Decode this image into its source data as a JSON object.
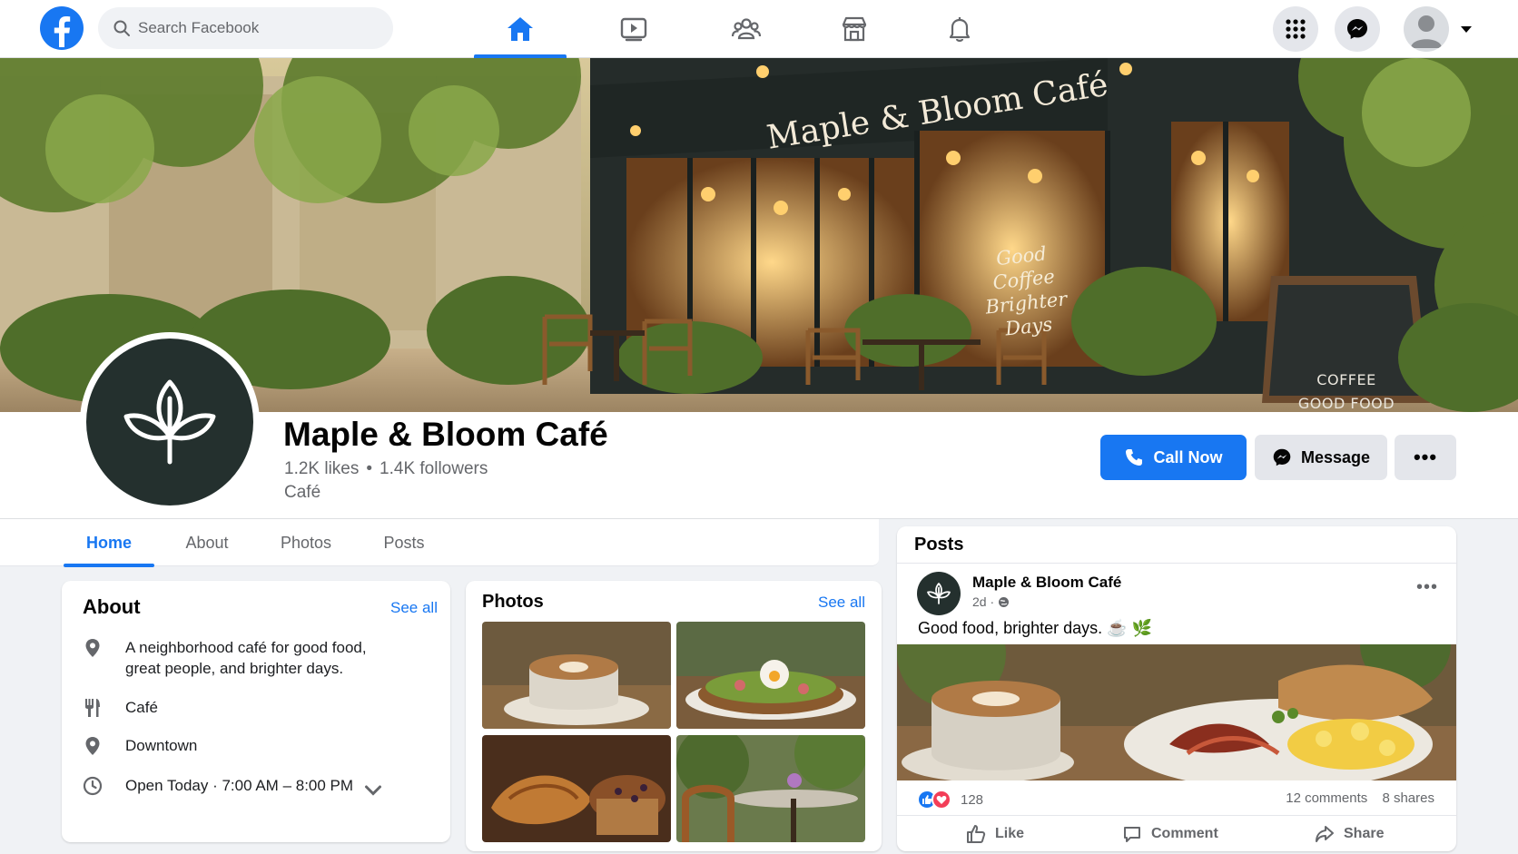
{
  "nav": {
    "search_placeholder": "Search Facebook",
    "tabs": [
      "home-icon",
      "watch-icon",
      "groups-icon",
      "marketplace-icon",
      "notifications-icon"
    ],
    "active_tab": "home",
    "accent": "#1877f2"
  },
  "cover": {
    "sign": "Maple & Bloom Café",
    "window_text": "Good\nCoffee\nBrighter\nDays",
    "board_text": "COFFEE\nGOOD FOOD\nGREAT PEOPLE"
  },
  "page": {
    "name": "Maple & Bloom Café",
    "likes": "1.2K likes",
    "followers": "1.4K followers",
    "stats_sep": "•",
    "category": "Café",
    "call_label": "Call Now",
    "message_label": "Message",
    "more_label": "•••"
  },
  "tabs": {
    "home": "Home",
    "about": "About",
    "photos": "Photos",
    "posts": "Posts"
  },
  "about": {
    "title": "About",
    "see_all": "See all",
    "description": "A neighborhood café for good food, great people, and brighter days.",
    "category": "Café",
    "location": "Downtown",
    "hours": "Open Today · 7:00 AM – 8:00 PM"
  },
  "photos": {
    "title": "Photos",
    "see_all": "See all",
    "items": [
      "latte",
      "avocado-toast",
      "pastries",
      "patio"
    ]
  },
  "posts": {
    "title": "Posts",
    "author": "Maple & Bloom Café",
    "time": "2d ·",
    "text": "Good food, brighter days. ☕ 🌿",
    "more": "•••",
    "reaction_count": "128",
    "comments": "12 comments",
    "shares": "8 shares",
    "like_label": "Like",
    "comment_label": "Comment",
    "share_label": "Share"
  }
}
